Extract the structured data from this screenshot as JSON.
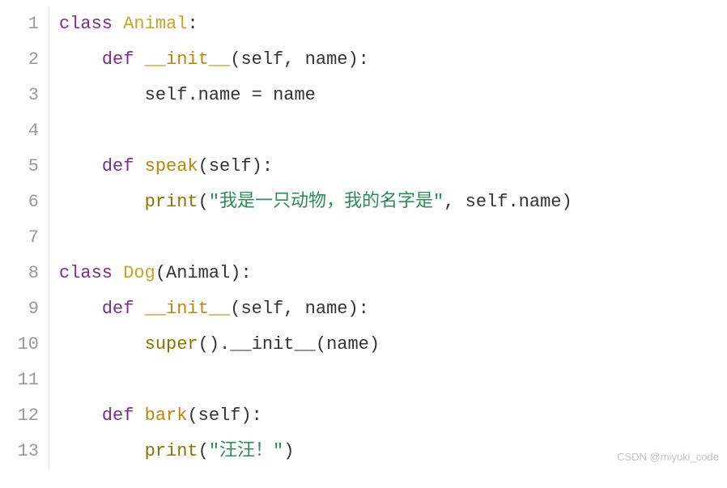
{
  "lineNumbers": [
    "1",
    "2",
    "3",
    "4",
    "5",
    "6",
    "7",
    "8",
    "9",
    "10",
    "11",
    "12",
    "13"
  ],
  "tokens": {
    "l1": {
      "class": "class ",
      "animal": "Animal",
      "colon": ":"
    },
    "l2": {
      "indent": "    ",
      "def": "def ",
      "init": "__init__",
      "open": "(",
      "self": "self",
      "comma": ", ",
      "name": "name",
      "close": "):"
    },
    "l3": {
      "indent": "        ",
      "self": "self",
      "dot": ".",
      "name1": "name",
      "eq": " = ",
      "name2": "name"
    },
    "l5": {
      "indent": "    ",
      "def": "def ",
      "speak": "speak",
      "open": "(",
      "self": "self",
      "close": "):"
    },
    "l6": {
      "indent": "        ",
      "print": "print",
      "open": "(",
      "str": "\"我是一只动物，我的名字是\"",
      "comma": ", ",
      "self": "self",
      "dot": ".",
      "name": "name",
      "close": ")"
    },
    "l8": {
      "class": "class ",
      "dog": "Dog",
      "open": "(",
      "animal": "Animal",
      "close": "):"
    },
    "l9": {
      "indent": "    ",
      "def": "def ",
      "init": "__init__",
      "open": "(",
      "self": "self",
      "comma": ", ",
      "name": "name",
      "close": "):"
    },
    "l10": {
      "indent": "        ",
      "super": "super",
      "paren": "()",
      "dot": ".",
      "init": "__init__",
      "open": "(",
      "name": "name",
      "close": ")"
    },
    "l12": {
      "indent": "    ",
      "def": "def ",
      "bark": "bark",
      "open": "(",
      "self": "self",
      "close": "):"
    },
    "l13": {
      "indent": "        ",
      "print": "print",
      "open": "(",
      "str": "\"汪汪！\"",
      "close": ")"
    }
  },
  "watermark": "CSDN @miyuki_code"
}
